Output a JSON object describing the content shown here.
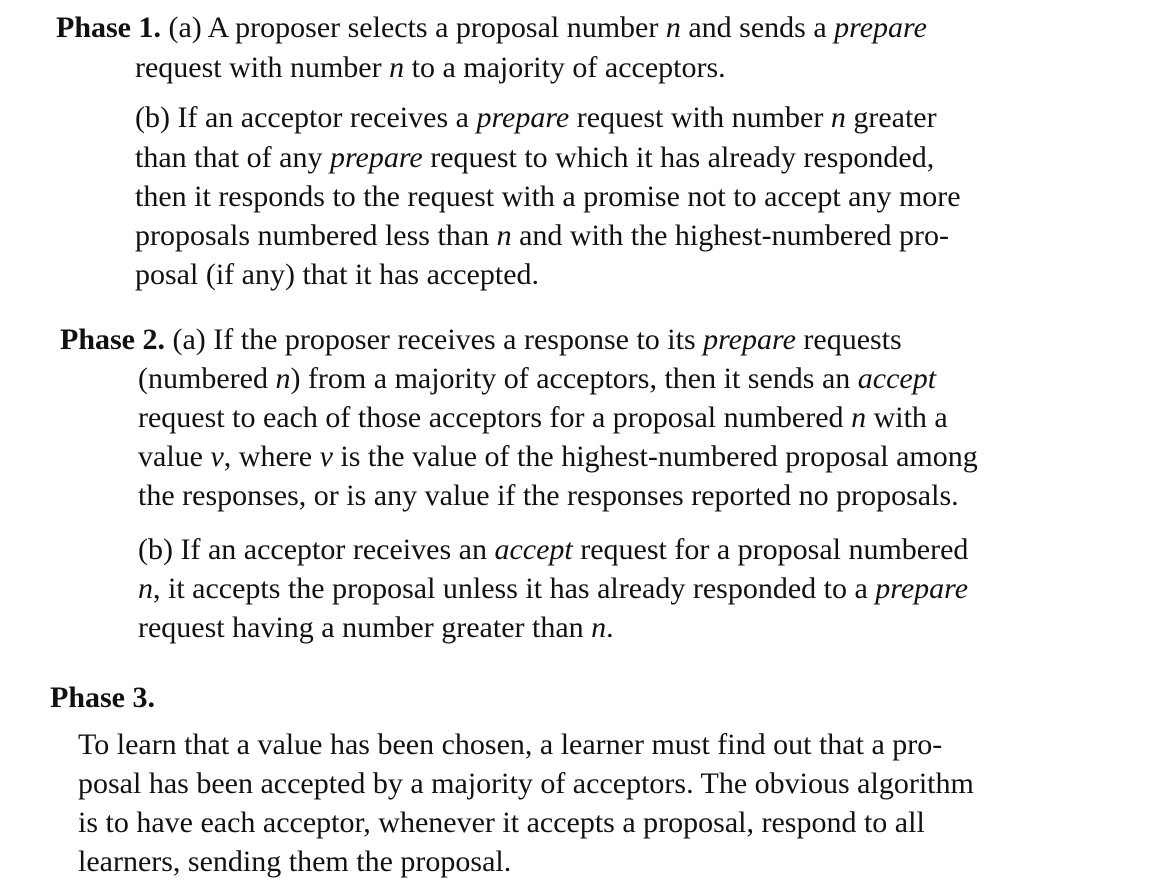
{
  "phase1": {
    "heading": "Phase 1.",
    "a": [
      "(a) A proposer selects a proposal number ",
      "n",
      " and sends a ",
      "prepare",
      "request with number ",
      "n",
      " to a majority of acceptors."
    ],
    "b_lines": [
      [
        "(b) If an acceptor receives a ",
        "prepare",
        " request with number ",
        "n",
        " greater"
      ],
      [
        "than that of any ",
        "prepare",
        " request to which it has already responded,"
      ],
      [
        "then it responds to the request with a promise not to accept any more"
      ],
      [
        "proposals numbered less than ",
        "n",
        " and with the highest-numbered pro-"
      ],
      [
        "posal (if any) that it has accepted."
      ]
    ]
  },
  "phase2": {
    "heading": "Phase 2.",
    "a_lines": [
      [
        "(a) If the proposer receives a response to its ",
        "prepare",
        " requests"
      ],
      [
        "(numbered ",
        "n",
        ") from a majority of acceptors, then it sends an ",
        "accept"
      ],
      [
        "request to each of those acceptors for a proposal numbered ",
        "n",
        " with a"
      ],
      [
        "value ",
        "v",
        ", where ",
        "v",
        " is the value of the highest-numbered proposal among"
      ],
      [
        "the responses, or is any value if the responses reported no proposals."
      ]
    ],
    "b_lines": [
      [
        "(b) If an acceptor receives an ",
        "accept",
        " request for a proposal numbered"
      ],
      [
        "n",
        ", it accepts the proposal unless it has already responded to a ",
        "prepare"
      ],
      [
        "request having a number greater than ",
        "n",
        "."
      ]
    ]
  },
  "phase3": {
    "heading": "Phase 3.",
    "lines": [
      "To learn that a value has been chosen, a learner must find out that a pro-",
      "posal has been accepted by a majority of acceptors. The obvious algorithm",
      "is to have each acceptor, whenever it accepts a proposal, respond to all",
      "learners, sending them the proposal."
    ]
  }
}
